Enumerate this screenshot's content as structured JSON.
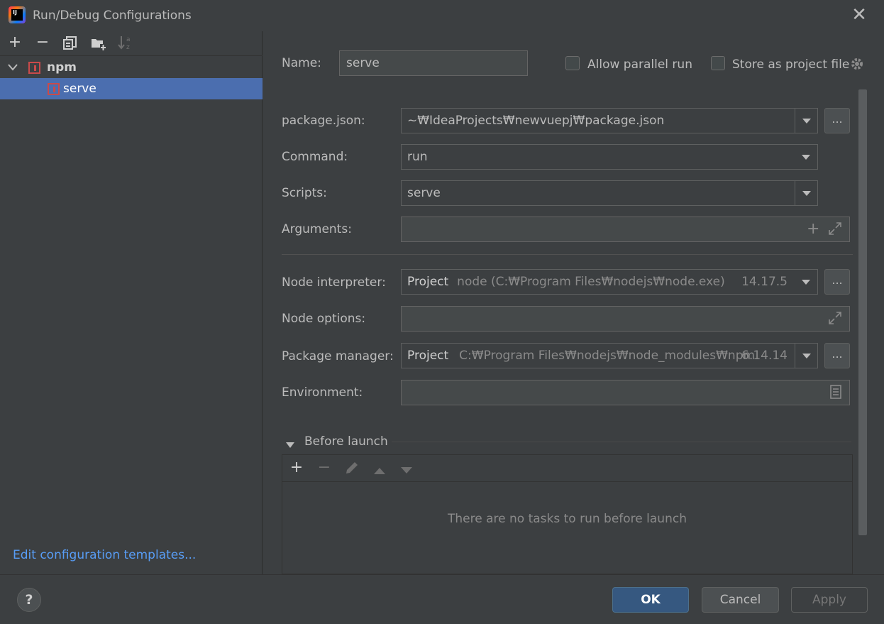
{
  "window": {
    "title": "Run/Debug Configurations",
    "close_glyph": "✕"
  },
  "sidebar": {
    "toolbar_glyphs": {
      "add": "+",
      "remove": "−"
    },
    "tree": {
      "group_label": "npm",
      "item_label": "serve"
    },
    "edit_templates_link": "Edit configuration templates..."
  },
  "form": {
    "name_label": "Name:",
    "name_value": "serve",
    "allow_parallel_label": "Allow parallel run",
    "store_project_label": "Store as project file",
    "package_json_label": "package.json:",
    "package_json_value": "~₩IdeaProjects₩newvuepj₩package.json",
    "command_label": "Command:",
    "command_value": "run",
    "scripts_label": "Scripts:",
    "scripts_value": "serve",
    "arguments_label": "Arguments:",
    "arguments_value": "",
    "node_interpreter_label": "Node interpreter:",
    "node_interpreter_scope": "Project",
    "node_interpreter_path": "node (C:₩Program Files₩nodejs₩node.exe)",
    "node_interpreter_version": "14.17.5",
    "node_options_label": "Node options:",
    "package_manager_label": "Package manager:",
    "package_manager_scope": "Project",
    "package_manager_path": "C:₩Program Files₩nodejs₩node_modules₩npm",
    "package_manager_version": "6.14.14",
    "environment_label": "Environment:",
    "browse_glyph": "..."
  },
  "before_launch": {
    "title": "Before launch",
    "add_glyph": "+",
    "remove_glyph": "−",
    "empty_text": "There are no tasks to run before launch"
  },
  "footer": {
    "help_glyph": "?",
    "ok_label": "OK",
    "cancel_label": "Cancel",
    "apply_label": "Apply"
  }
}
